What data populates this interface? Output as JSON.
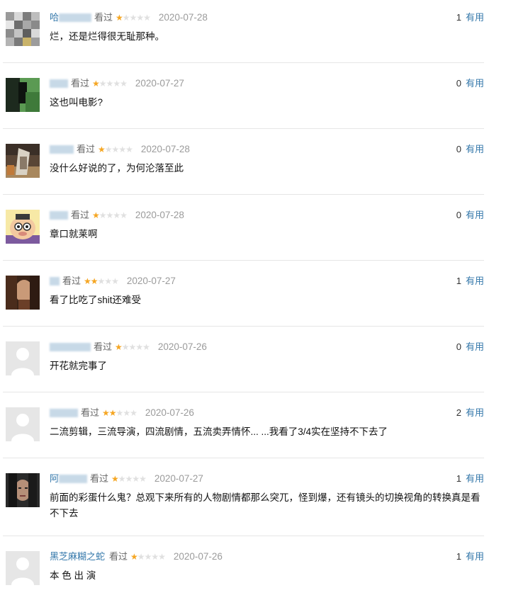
{
  "comments": [
    {
      "user": "哈",
      "user_blur_width": 46,
      "status": "看过",
      "rating": 1,
      "date": "2020-07-28",
      "votes": "1",
      "vote_label": "有用",
      "text": "烂，还是烂得很无耻那种。",
      "avatar": "avatar-pixelated"
    },
    {
      "user": "",
      "user_blur_width": 26,
      "status": "看过",
      "rating": 1,
      "date": "2020-07-27",
      "votes": "0",
      "vote_label": "有用",
      "text": "这也叫电影?",
      "avatar": "avatar-green"
    },
    {
      "user": "",
      "user_blur_width": 34,
      "status": "看过",
      "rating": 1,
      "date": "2020-07-28",
      "votes": "0",
      "vote_label": "有用",
      "text": "没什么好说的了，为何沦落至此",
      "avatar": "avatar-figure"
    },
    {
      "user": "",
      "user_blur_width": 26,
      "status": "看过",
      "rating": 1,
      "date": "2020-07-28",
      "votes": "0",
      "vote_label": "有用",
      "text": "章口就莱啊",
      "avatar": "avatar-cartoon"
    },
    {
      "user": "",
      "user_blur_width": 14,
      "status": "看过",
      "rating": 2,
      "date": "2020-07-27",
      "votes": "1",
      "vote_label": "有用",
      "text": "看了比吃了shit还难受",
      "avatar": "avatar-portrait"
    },
    {
      "user": "",
      "user_blur_width": 58,
      "status": "看过",
      "rating": 1,
      "date": "2020-07-26",
      "votes": "0",
      "vote_label": "有用",
      "text": "开花就完事了",
      "avatar": "avatar-default"
    },
    {
      "user": "",
      "user_blur_width": 40,
      "status": "看过",
      "rating": 2,
      "date": "2020-07-26",
      "votes": "2",
      "vote_label": "有用",
      "text": "二流剪辑，三流导演，四流剧情，五流卖弄情怀... ...我看了3/4实在坚持不下去了",
      "avatar": "avatar-default"
    },
    {
      "user": "阿",
      "user_blur_width": 40,
      "status": "看过",
      "rating": 1,
      "date": "2020-07-27",
      "votes": "1",
      "vote_label": "有用",
      "text": "前面的彩蛋什么鬼？总观下来所有的人物剧情都那么突兀，怪到爆，还有镜头的切换视角的转换真是看不下去",
      "avatar": "avatar-dark"
    },
    {
      "user": "黑芝麻糊之蛇",
      "user_blur_width": 0,
      "status": "看过",
      "rating": 1,
      "date": "2020-07-26",
      "votes": "1",
      "vote_label": "有用",
      "text": "本 色 出 演",
      "avatar": "avatar-default"
    }
  ],
  "colors": {
    "link": "#3377aa",
    "star_on": "#f5a623",
    "star_off": "#e0e0e0",
    "date": "#9b9b9b",
    "divider": "#e6e6e6"
  }
}
